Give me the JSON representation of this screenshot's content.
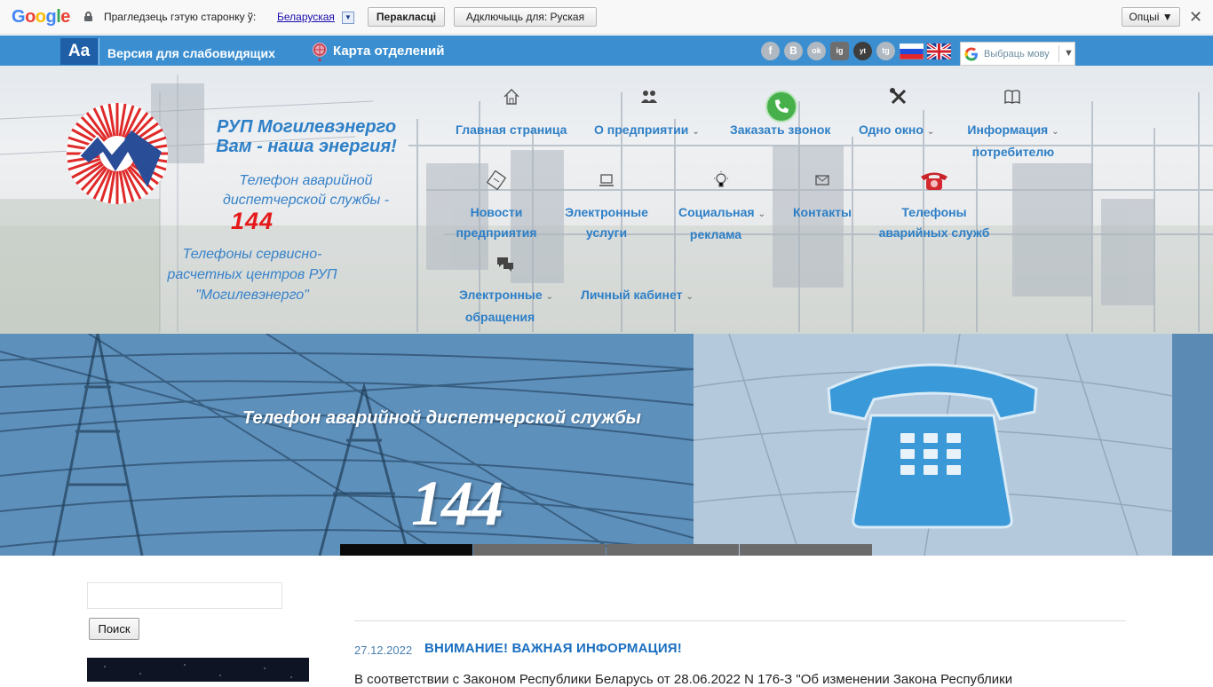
{
  "translate_bar": {
    "logo": "Google",
    "prompt": "Прагледзець гэтую старонку ў:",
    "language": "Беларуская",
    "translate_button": "Пераклaсці",
    "disable_button": "Адключыць для: Руская",
    "options_button": "Опцыі ▼",
    "close": "✕"
  },
  "topbar": {
    "aa": "Aa",
    "vision_link": "Версия для слабовидящих",
    "map_link": "Карта отделений",
    "social": [
      "f",
      "B",
      "ok",
      "ig",
      "yt",
      "tg"
    ],
    "lang_select_label": "Выбраць мову",
    "lang_select_arrow": "▼"
  },
  "header": {
    "company_line1": "РУП Могилевэнерго",
    "company_line2": "Вам - наша энергия!",
    "emergency_line1": "Телефон аварийной",
    "emergency_line2": "диспетчерской службы -",
    "emergency_number": "144",
    "service_line1": "Телефоны сервисно-",
    "service_line2": "расчетных центров РУП",
    "service_line3": "\"Могилевэнерго\""
  },
  "nav": {
    "home": "Главная страница",
    "about": "О предприятии",
    "callback": "Заказать звонок",
    "one_window": "Одно окно",
    "info1": "Информация",
    "info2": "потребителю",
    "news1": "Новости",
    "news2": "предприятия",
    "eserv1": "Электронные",
    "eserv2": "услуги",
    "social1": "Социальная",
    "social2": "реклама",
    "contacts": "Контакты",
    "emerg1": "Телефоны",
    "emerg2": "аварийных служб",
    "eappeal1": "Электронные",
    "eappeal2": "обращения",
    "cabinet": "Личный кабинет",
    "caret": "⌄"
  },
  "slider": {
    "title": "Телефон аварийной диспетчерской службы",
    "number": "144",
    "dots": 4,
    "active_dot": 0
  },
  "sidebar": {
    "search_placeholder": "",
    "search_button": "Поиск"
  },
  "post": {
    "date": "27.12.2022",
    "title": "ВНИМАНИЕ! ВАЖНАЯ ИНФОРМАЦИЯ!",
    "text": "В соответствии с Законом Республики Беларусь от 28.06.2022 N 176-З \"Об изменении Закона Республики"
  },
  "colors": {
    "strip_blue": "#3b8fd1",
    "nav_blue": "#2d7fc7",
    "emergency_red": "#e51a1a"
  }
}
